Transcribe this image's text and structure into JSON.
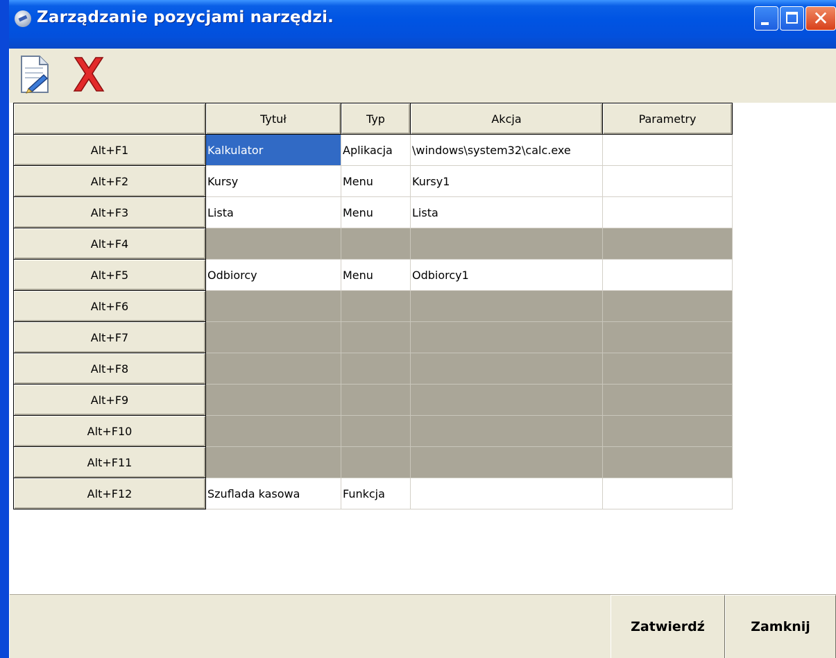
{
  "window": {
    "title": "Zarządzanie pozycjami narzędzi.",
    "close_glyph": "✕"
  },
  "toolbar": {
    "icons": [
      "new-document-icon",
      "delete-icon"
    ]
  },
  "table": {
    "columns": [
      "",
      "Tytuł",
      "Typ",
      "Akcja",
      "Parametry"
    ],
    "rows": [
      {
        "key": "Alt+F1",
        "title": "Kalkulator",
        "type": "Aplikacja",
        "action": "\\windows\\system32\\calc.exe",
        "params": ""
      },
      {
        "key": "Alt+F2",
        "title": "Kursy",
        "type": "Menu",
        "action": "Kursy1",
        "params": ""
      },
      {
        "key": "Alt+F3",
        "title": "Lista",
        "type": "Menu",
        "action": "Lista",
        "params": ""
      },
      {
        "key": "Alt+F4",
        "title": "",
        "type": "",
        "action": "",
        "params": ""
      },
      {
        "key": "Alt+F5",
        "title": "Odbiorcy",
        "type": "Menu",
        "action": "Odbiorcy1",
        "params": ""
      },
      {
        "key": "Alt+F6",
        "title": "",
        "type": "",
        "action": "",
        "params": ""
      },
      {
        "key": "Alt+F7",
        "title": "",
        "type": "",
        "action": "",
        "params": ""
      },
      {
        "key": "Alt+F8",
        "title": "",
        "type": "",
        "action": "",
        "params": ""
      },
      {
        "key": "Alt+F9",
        "title": "",
        "type": "",
        "action": "",
        "params": ""
      },
      {
        "key": "Alt+F10",
        "title": "",
        "type": "",
        "action": "",
        "params": ""
      },
      {
        "key": "Alt+F11",
        "title": "",
        "type": "",
        "action": "",
        "params": ""
      },
      {
        "key": "Alt+F12",
        "title": "Szuflada kasowa",
        "type": "Funkcja",
        "action": "",
        "params": ""
      }
    ]
  },
  "buttons": {
    "confirm": "Zatwierdź",
    "close": "Zamknij"
  },
  "colors": {
    "titlebar": "#0054e3",
    "selection": "#316ac5",
    "empty_row": "#aaa698",
    "face": "#ece9d8"
  }
}
